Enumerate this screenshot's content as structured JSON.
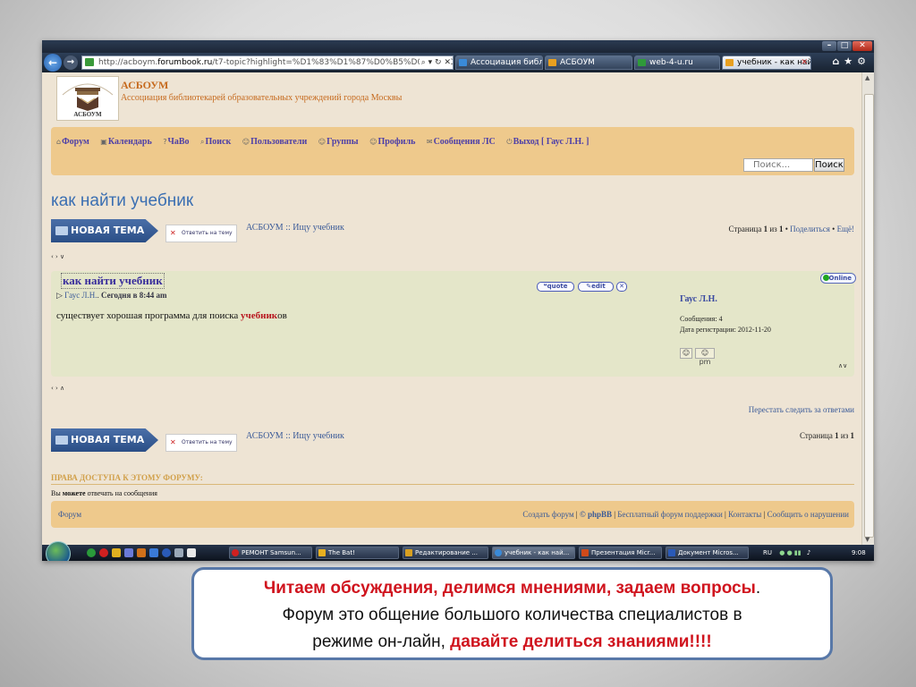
{
  "browser": {
    "address": "http://acboym.forumbook.ru/t7-topic?highlight=%D1%83%D1%87%D0%B5%D0%B1%D0%BD%D0%B8",
    "address_prefix": "http://acboym.",
    "address_domain": "forumbook.ru",
    "address_rest": "/t7-topic?highlight=%D1%83%D1%87%D0%B5%D0%B1%D0%BD%D0%B8",
    "address_controls": "⌕ ▾ ↻ ✕",
    "tabs": [
      {
        "label": "Ассоциация библио...",
        "color": "#3a8ad8"
      },
      {
        "label": "АСБОУМ",
        "color": "#e8a020"
      },
      {
        "label": "web-4-u.ru",
        "color": "#2f9a3a"
      },
      {
        "label": "учебник - как най...",
        "color": "#e8a020"
      }
    ],
    "tab_close": "✕",
    "nav_icons": "⌂★⚙"
  },
  "site": {
    "title": "АСБОУМ",
    "subtitle": "Ассоциация библиотекарей образовательных учреждений города Москвы",
    "logo_text": "АСБОУМ"
  },
  "menu": [
    {
      "icon": "⌂",
      "label": "Форум"
    },
    {
      "icon": "▣",
      "label": "Календарь"
    },
    {
      "icon": "?",
      "label": "ЧаВо"
    },
    {
      "icon": "⌕",
      "label": "Поиск"
    },
    {
      "icon": "☺",
      "label": "Пользователи"
    },
    {
      "icon": "☺",
      "label": "Группы"
    },
    {
      "icon": "☺",
      "label": "Профиль"
    },
    {
      "icon": "✉",
      "label": "Сообщения ЛС"
    },
    {
      "icon": "⏻",
      "label": "Выход [ Гаус Л.Н. ]"
    }
  ],
  "search": {
    "placeholder": "Поиск...",
    "button": "Поиск"
  },
  "topic": {
    "title": "как найти учебник",
    "new_topic_button": "НОВАЯ ТЕМА",
    "reply_button": "Ответить на тему",
    "crumb_forum": "АСБОУМ",
    "crumb_sep": " :: ",
    "crumb_section": "Ищу учебник",
    "pagination_top": {
      "prefix": "Страница ",
      "current": "1",
      "mid": " из ",
      "total": "1",
      "share": "Поделиться",
      "more": "Ещё!"
    },
    "pagination_bottom": {
      "prefix": "Страница ",
      "current": "1",
      "mid": " из ",
      "total": "1"
    },
    "nav_top": "‹ › ∨",
    "nav_bottom": "‹ › ∧",
    "stop_follow": "Перестать следить за ответами"
  },
  "post": {
    "title": "как найти учебник",
    "author": "Гаус Л.Н.",
    "date_label": "Сегодня в 8:44 am",
    "body_before": "существует хорошая программа для поиска ",
    "body_highlight": "учебник",
    "body_after": "ов",
    "btn_quote": "quote",
    "btn_edit": "edit",
    "btn_delete": "✕",
    "online": "Online",
    "author_name": "Гаус Л.Н.",
    "messages": "Сообщения: 4",
    "registered": "Дата регистрации: 2012-11-20",
    "icon_profile": "☺",
    "icon_pm": "☺pm",
    "updown": "∧∨"
  },
  "permissions": {
    "heading": "ПРАВА ДОСТУПА К ЭТОМУ ФОРУМУ:",
    "before": "Вы ",
    "bold": "можете",
    "after": " отвечать на сообщения"
  },
  "footer": {
    "left": "Форум",
    "links": [
      "Создать форум",
      "© phpBB",
      "Бесплатный форум поддержки",
      "Контакты",
      "Сообщить о нарушении"
    ],
    "sep": " | "
  },
  "taskbar": {
    "items": [
      {
        "label": "РЕМОНТ Samsun...",
        "color": "#d02020"
      },
      {
        "label": "The Bat!",
        "color": "#e8b020"
      },
      {
        "label": "Редактирование ...",
        "color": "#d8a020"
      },
      {
        "label": "учебник - как най...",
        "color": "#3a8ad8"
      },
      {
        "label": "Презентация Micr...",
        "color": "#d04a1a"
      },
      {
        "label": "Документ Micros...",
        "color": "#2a5ab8"
      }
    ],
    "lang": "RU",
    "clock": "9:08"
  },
  "callout": {
    "line1_red": "Читаем обсуждения, делимся мнениями, задаем вопросы",
    "line1_end": ".",
    "line2": "Форум это общение большого количества специалистов в",
    "line3_start": "режиме он-лайн, ",
    "line3_red": "давайте делиться знаниями!!!!"
  }
}
